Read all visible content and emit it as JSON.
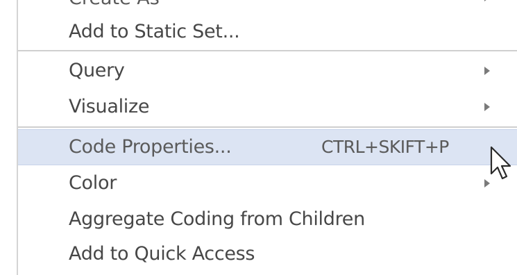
{
  "menu": {
    "cut_item": {
      "label": "Create As"
    },
    "items": [
      {
        "label": "Add to Static Set...",
        "shortcut": "",
        "submenu": false
      },
      {
        "label": "Query",
        "shortcut": "",
        "submenu": true
      },
      {
        "label": "Visualize",
        "shortcut": "",
        "submenu": true
      },
      {
        "label": "Code Properties...",
        "shortcut": "CTRL+SKIFT+P",
        "submenu": false,
        "highlighted": true
      },
      {
        "label": "Color",
        "shortcut": "",
        "submenu": true
      },
      {
        "label": "Aggregate Coding from Children",
        "shortcut": "",
        "submenu": false
      },
      {
        "label": "Add to Quick Access",
        "shortcut": "",
        "submenu": false
      }
    ]
  },
  "icons": {
    "submenu": "chevron-right-icon",
    "cursor": "mouse-pointer-icon"
  },
  "colors": {
    "highlight_bg": "#dce4f3",
    "text": "#474747",
    "separator": "#cfcfcf"
  }
}
